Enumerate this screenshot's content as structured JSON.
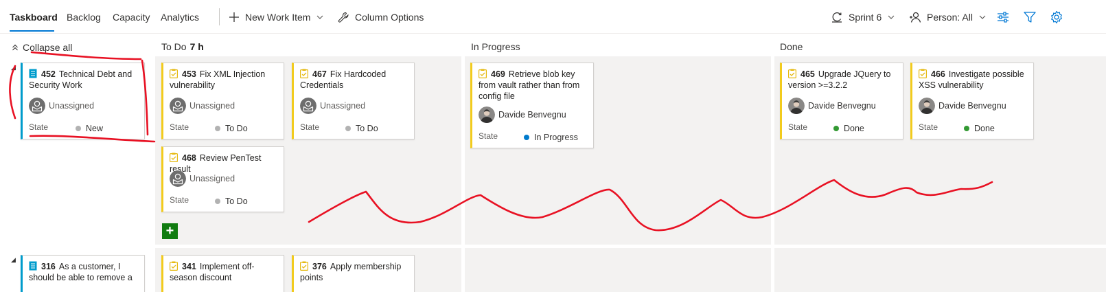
{
  "nav": {
    "tabs": [
      {
        "label": "Taskboard",
        "active": true
      },
      {
        "label": "Backlog"
      },
      {
        "label": "Capacity"
      },
      {
        "label": "Analytics"
      }
    ]
  },
  "toolbar": {
    "new_work_item": "New Work Item",
    "column_options": "Column Options",
    "sprint": "Sprint 6",
    "person_filter": "Person: All",
    "icons": [
      "plus-icon",
      "wrench-icon",
      "sprint-icon",
      "person-icon",
      "settings-sliders-icon",
      "filter-icon",
      "gear-icon"
    ]
  },
  "board": {
    "collapse_all": "Collapse all",
    "columns": [
      {
        "name": "To Do",
        "extra": "7 h"
      },
      {
        "name": "In Progress",
        "extra": ""
      },
      {
        "name": "Done",
        "extra": ""
      }
    ],
    "state_label": "State",
    "state_colors": {
      "New": "#b2b2b2",
      "To Do": "#b2b2b2",
      "In Progress": "#007acc",
      "Done": "#339933"
    },
    "rows": [
      {
        "parent": {
          "id": "452",
          "title": "Technical Debt and Security Work",
          "assignee": "Unassigned",
          "state": "New"
        },
        "todo": [
          {
            "id": "453",
            "title": "Fix XML Injection vulnerability",
            "assignee": "Unassigned",
            "state": "To Do"
          },
          {
            "id": "467",
            "title": "Fix Hardcoded Credentials",
            "assignee": "Unassigned",
            "state": "To Do"
          },
          {
            "id": "468",
            "title": "Review PenTest result",
            "assignee": "Unassigned",
            "state": "To Do"
          }
        ],
        "in_progress": [
          {
            "id": "469",
            "title": "Retrieve blob key from vault rather than from config file",
            "assignee": "Davide Benvegnu",
            "state": "In Progress"
          }
        ],
        "done": [
          {
            "id": "465",
            "title": "Upgrade JQuery to version >=3.2.2",
            "assignee": "Davide Benvegnu",
            "state": "Done"
          },
          {
            "id": "466",
            "title": "Investigate possible XSS vulnerability",
            "assignee": "Davide Benvegnu",
            "state": "Done"
          }
        ]
      },
      {
        "parent": {
          "id": "316",
          "title": "As a customer, I should be able to remove a"
        },
        "todo": [
          {
            "id": "341",
            "title": "Implement off-season discount"
          },
          {
            "id": "376",
            "title": "Apply membership points"
          }
        ]
      }
    ]
  },
  "colors": {
    "accent": "#0078d4",
    "task_bar": "#f2cb1d",
    "pbi_bar": "#009ccc",
    "add_button": "#107c10",
    "annotation": "#e81123"
  }
}
